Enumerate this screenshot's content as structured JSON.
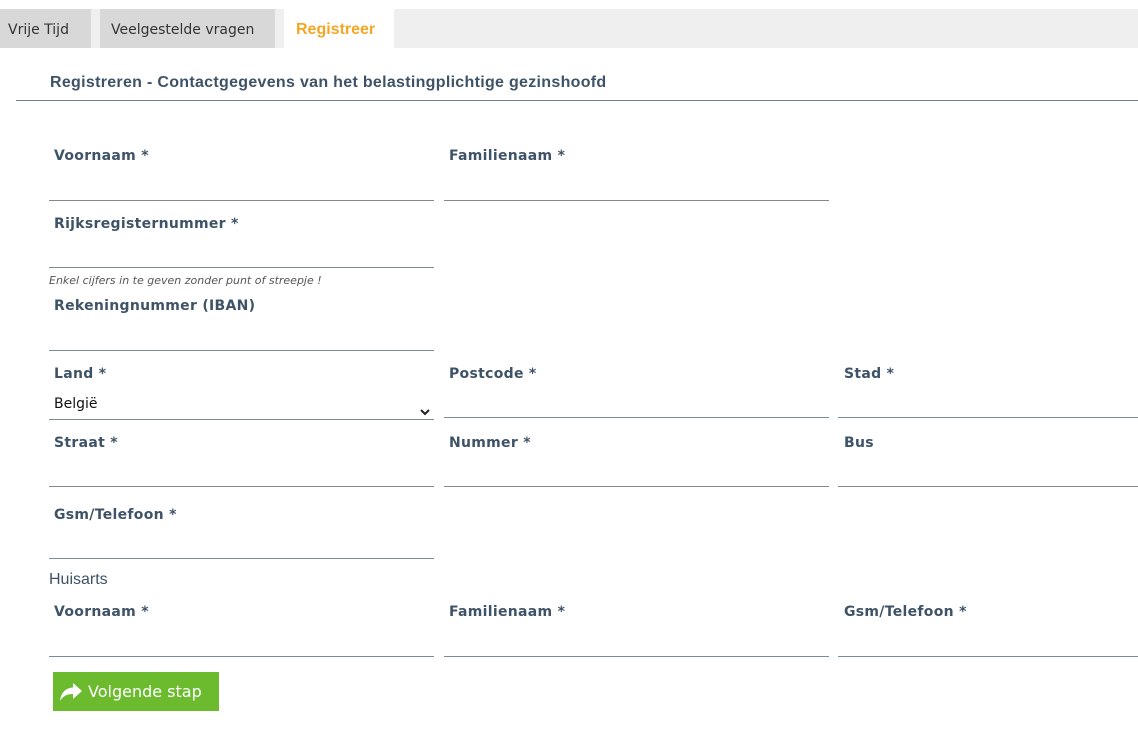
{
  "tabs": [
    {
      "label": "Vrije Tijd",
      "active": false
    },
    {
      "label": "Veelgestelde vragen",
      "active": false
    },
    {
      "label": "Registreer",
      "active": true
    }
  ],
  "page_title": "Registreren - Contactgegevens van het belastingplichtige gezinshoofd",
  "fields": {
    "voornaam": {
      "label": "Voornaam *",
      "value": ""
    },
    "familienaam": {
      "label": "Familienaam *",
      "value": ""
    },
    "rijksregisternummer": {
      "label": "Rijksregisternummer *",
      "value": "",
      "hint": "Enkel cijfers in te geven zonder punt of streepje !"
    },
    "rekeningnummer": {
      "label": "Rekeningnummer (IBAN)",
      "value": ""
    },
    "land": {
      "label": "Land *",
      "selected": "België"
    },
    "postcode": {
      "label": "Postcode *",
      "value": ""
    },
    "stad": {
      "label": "Stad *",
      "value": ""
    },
    "straat": {
      "label": "Straat *",
      "value": ""
    },
    "nummer": {
      "label": "Nummer *",
      "value": ""
    },
    "bus": {
      "label": "Bus",
      "value": ""
    },
    "gsm": {
      "label": "Gsm/Telefoon *",
      "value": ""
    }
  },
  "huisarts": {
    "heading": "Huisarts",
    "voornaam": {
      "label": "Voornaam *",
      "value": ""
    },
    "familienaam": {
      "label": "Familienaam *",
      "value": ""
    },
    "gsm": {
      "label": "Gsm/Telefoon *",
      "value": ""
    }
  },
  "next_button": {
    "label": "Volgende stap",
    "icon": "share-arrow-icon",
    "color": "#6cba2e"
  },
  "colors": {
    "accent": "#f5a623",
    "label": "#3e5367",
    "button": "#6cba2e"
  }
}
